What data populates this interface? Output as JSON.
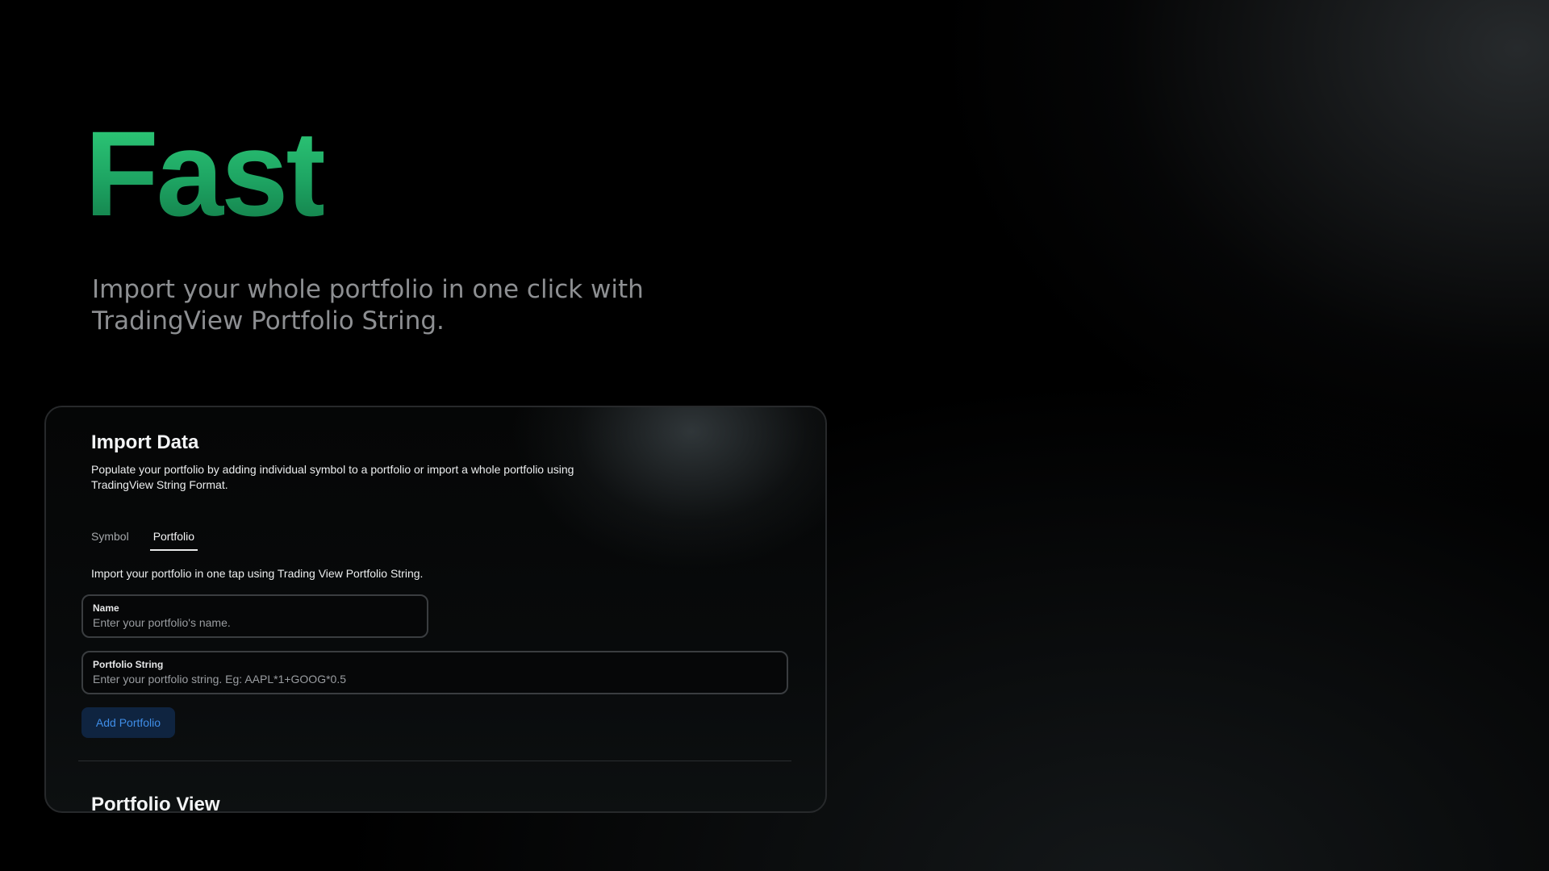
{
  "hero": {
    "title": "Fast",
    "subtitle": "Import your whole portfolio in one click with TradingView Portfolio String."
  },
  "import_card": {
    "title": "Import Data",
    "description": "Populate your portfolio by adding individual symbol to a portfolio or import a whole portfolio using TradingView String Format.",
    "tabs": [
      {
        "label": "Symbol",
        "active": false
      },
      {
        "label": "Portfolio",
        "active": true
      }
    ],
    "tab_hint": "Import your portfolio in one tap using Trading View Portfolio String.",
    "fields": {
      "name": {
        "label": "Name",
        "value": "",
        "placeholder": "Enter your portfolio's name."
      },
      "portfolio_string": {
        "label": "Portfolio String",
        "value": "",
        "placeholder": "Enter your portfolio string. Eg: AAPL*1+GOOG*0.5"
      }
    },
    "add_button_label": "Add Portfolio",
    "next_section_title": "Portfolio View"
  },
  "colors": {
    "accent_green": "#2fce7a",
    "button_text_blue": "#3f8ee8",
    "button_bg": "#0f2440"
  }
}
